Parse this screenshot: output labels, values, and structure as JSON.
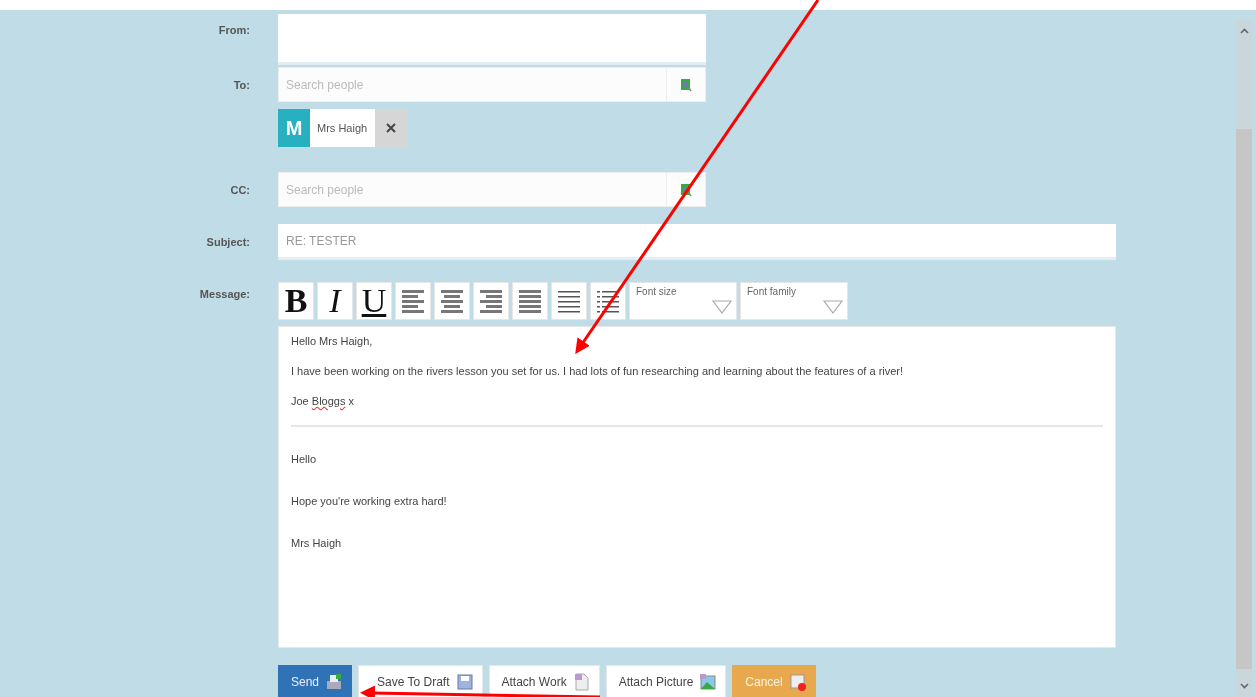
{
  "form": {
    "from": {
      "label": "From:"
    },
    "to": {
      "label": "To:",
      "placeholder": "Search people",
      "recipients": [
        {
          "initial": "M",
          "name": "Mrs Haigh"
        }
      ]
    },
    "cc": {
      "label": "CC:",
      "placeholder": "Search people"
    },
    "subject": {
      "label": "Subject:",
      "value": "RE: TESTER"
    },
    "message": {
      "label": "Message:",
      "toolbar": [
        {
          "kind": "bold",
          "text": "B"
        },
        {
          "kind": "italic",
          "text": "I"
        },
        {
          "kind": "underline",
          "text": "U"
        },
        {
          "kind": "left"
        },
        {
          "kind": "center"
        },
        {
          "kind": "right"
        },
        {
          "kind": "justify"
        },
        {
          "kind": "numbered"
        },
        {
          "kind": "bulleted"
        },
        {
          "kind": "select",
          "text": "Font size"
        },
        {
          "kind": "select",
          "text": "Font family"
        }
      ],
      "reply": [
        [
          {
            "text": "Hello Mrs Haigh,",
            "misspelled": false
          }
        ],
        [
          {
            "text": "I have been working on the rivers lesson you set for us. I had lots of fun researching and learning about the features of a river!",
            "misspelled": false
          }
        ],
        [
          {
            "text": "Joe ",
            "misspelled": false
          },
          {
            "text": "Bloggs",
            "misspelled": true
          },
          {
            "text": " x",
            "misspelled": false
          }
        ]
      ],
      "quoted": [
        "Hello",
        "Hope you're working extra hard!",
        "Mrs Haigh"
      ]
    }
  },
  "buttons": [
    {
      "kind": "primary",
      "label": "Send"
    },
    {
      "kind": "default",
      "label": "Save To Draft"
    },
    {
      "kind": "default",
      "label": "Attach Work"
    },
    {
      "kind": "default",
      "label": "Attach Picture"
    },
    {
      "kind": "danger",
      "label": "Cancel"
    }
  ]
}
